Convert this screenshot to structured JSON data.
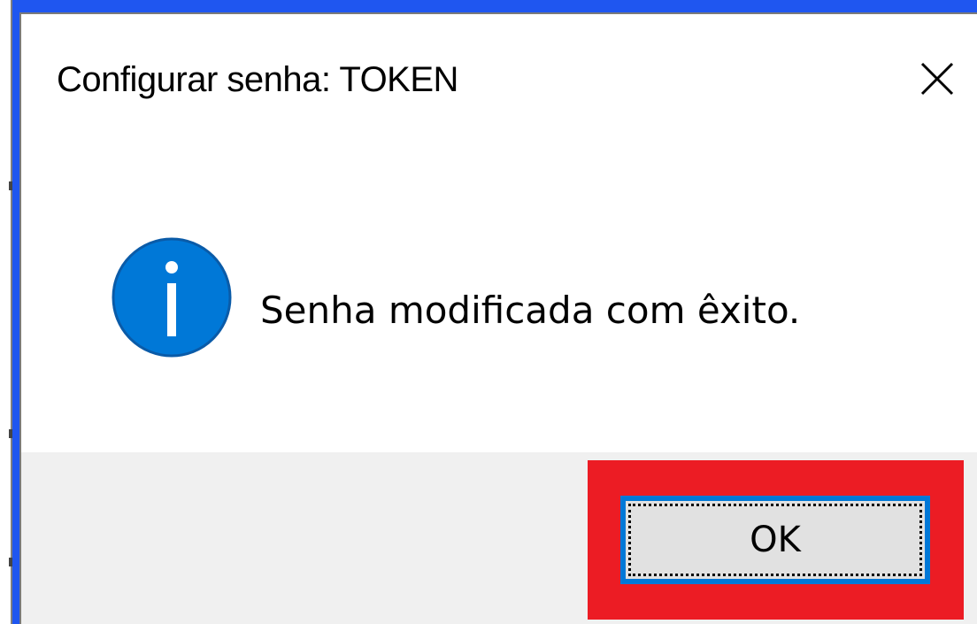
{
  "dialog": {
    "title": "Configurar senha: TOKEN",
    "close_icon": "close-icon",
    "message": "Senha modificada com êxito.",
    "message_icon": "info-icon",
    "ok_label": "OK"
  },
  "colors": {
    "desktop": "#1f56f0",
    "dialog_background": "#ffffff",
    "footer_background": "#f0f0f0",
    "info_icon": "#0078d7",
    "ok_focus_border": "#0078d7",
    "annotation_highlight": "#ec1c24"
  }
}
